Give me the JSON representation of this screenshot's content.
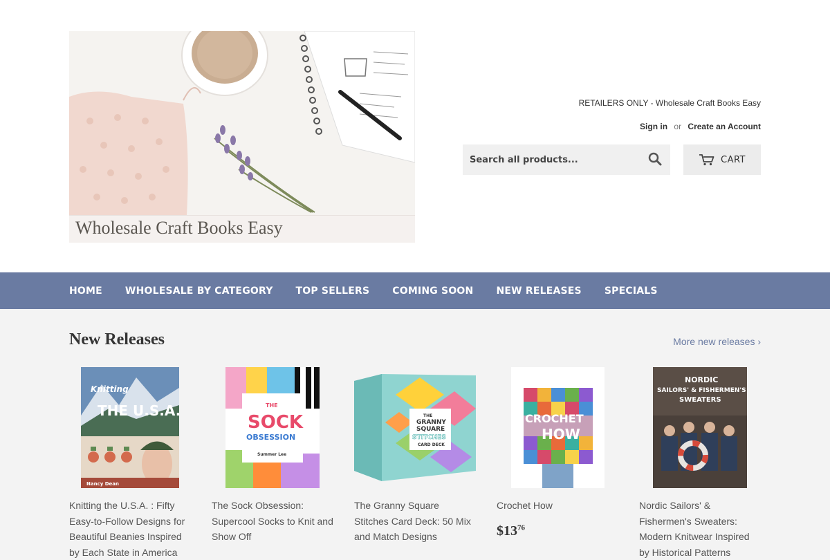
{
  "header": {
    "logo_text": "Wholesale Craft Books Easy",
    "retailers_notice": "RETAILERS ONLY - Wholesale Craft Books Easy",
    "sign_in": "Sign in",
    "or": "or",
    "create_account": "Create an Account",
    "search_placeholder": "Search all products...",
    "cart_label": "CART"
  },
  "nav": {
    "items": [
      {
        "label": "HOME"
      },
      {
        "label": "WHOLESALE BY CATEGORY"
      },
      {
        "label": "TOP SELLERS"
      },
      {
        "label": "COMING SOON"
      },
      {
        "label": "NEW RELEASES"
      },
      {
        "label": "SPECIALS"
      }
    ]
  },
  "section": {
    "title": "New Releases",
    "more_link": "More new releases ›"
  },
  "products": [
    {
      "title": "Knitting the U.S.A. : Fifty Easy-to-Follow Designs for Beautiful Beanies Inspired by Each State in America",
      "cover": {
        "l1": "Knitting",
        "l2": "THE U.S.A.",
        "author": "Nancy Dean"
      }
    },
    {
      "title": "The Sock Obsession: Supercool Socks to Knit and Show Off",
      "cover": {
        "l1": "THE",
        "l2": "SOCK",
        "l3": "OBSESSION",
        "author": "Summer Lee"
      }
    },
    {
      "title": "The Granny Square Stitches Card Deck: 50 Mix and Match Designs",
      "cover": {
        "l1": "THE",
        "l2": "GRANNY",
        "l3": "SQUARE",
        "l4": "STITCHES",
        "l5": "CARD DECK"
      }
    },
    {
      "title": "Crochet How",
      "price_main": "$13",
      "price_cents": "76",
      "cover": {
        "l1": "CROCHET",
        "l2": "HOW"
      }
    },
    {
      "title": "Nordic Sailors' & Fishermen's Sweaters: Modern Knitwear Inspired by Historical Patterns",
      "cover": {
        "l1": "NORDIC",
        "l2": "SAILORS' & FISHERMEN'S",
        "l3": "SWEATERS"
      }
    }
  ],
  "colors": {
    "nav_bg": "#6a7ba2",
    "link": "#6a7ba2",
    "page_bg": "#f3f3f3"
  }
}
